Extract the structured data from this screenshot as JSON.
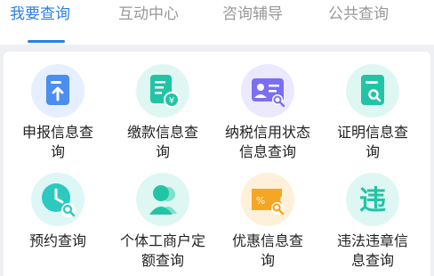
{
  "tabs": [
    {
      "label": "我要查询",
      "active": true
    },
    {
      "label": "互动中心",
      "active": false
    },
    {
      "label": "咨询辅导",
      "active": false
    },
    {
      "label": "公共查询",
      "active": false
    }
  ],
  "colors": {
    "accent": "#2a7fe8",
    "inactive_tab": "#999999",
    "text": "#222222"
  },
  "grid": [
    {
      "label": "申报信息查询",
      "icon": "upload-document-icon",
      "color": "#4a8ef0"
    },
    {
      "label": "缴款信息查询",
      "icon": "payment-receipt-icon",
      "color": "#22c4a6"
    },
    {
      "label": "纳税信用状态信息查询",
      "icon": "credit-card-search-icon",
      "color": "#7a6ff0"
    },
    {
      "label": "证明信息查询",
      "icon": "certificate-search-icon",
      "color": "#22c4a6"
    },
    {
      "label": "预约查询",
      "icon": "clock-search-icon",
      "color": "#2bc9c0"
    },
    {
      "label": "个体工商户定额查询",
      "icon": "person-icon",
      "color": "#22c4a6"
    },
    {
      "label": "优惠信息查询",
      "icon": "discount-ticket-icon",
      "color": "#f5a623"
    },
    {
      "label": "违法违章信息查询",
      "icon": "violation-icon",
      "color": "#22c4a6",
      "glyph": "违"
    }
  ]
}
